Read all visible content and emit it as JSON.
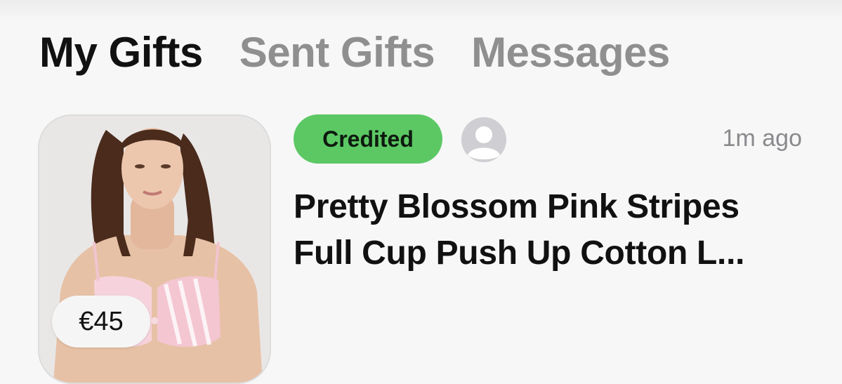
{
  "tabs": [
    {
      "label": "My Gifts",
      "active": true
    },
    {
      "label": "Sent Gifts",
      "active": false
    },
    {
      "label": "Messages",
      "active": false
    }
  ],
  "gift": {
    "price": "€45",
    "status": "Credited",
    "status_color": "#5cc864",
    "timestamp": "1m ago",
    "title_line1": "Pretty Blossom Pink Stripes",
    "title_line2": "Full Cup Push Up Cotton L...",
    "image": "product-photo-model-pink-bra",
    "avatar_icon": "person-placeholder-icon"
  },
  "colors": {
    "active_tab": "#111111",
    "inactive_tab": "#8f8f8f",
    "background": "#f7f7f7"
  }
}
